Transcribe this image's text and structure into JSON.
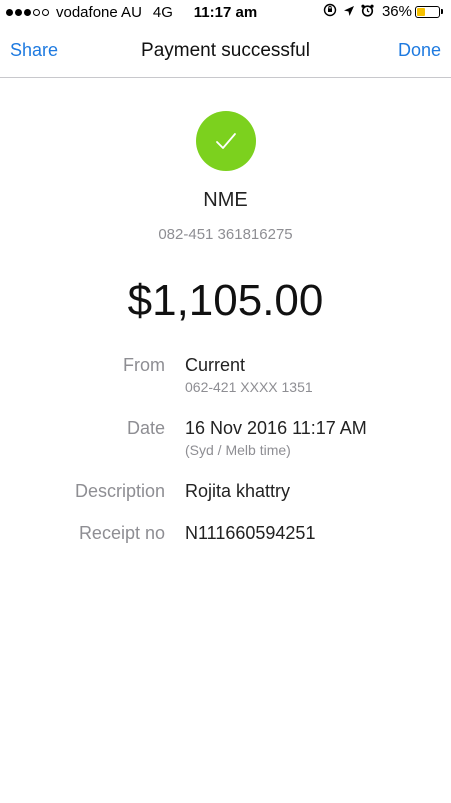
{
  "status_bar": {
    "signal_dots_full": 3,
    "signal_dots_empty": 2,
    "carrier": "vodafone AU",
    "network": "4G",
    "time": "11:17 am",
    "battery_percent": "36%",
    "battery_level": 0.36,
    "icons": [
      "rotation-lock-icon",
      "location-arrow-icon",
      "alarm-clock-icon"
    ]
  },
  "nav": {
    "share_label": "Share",
    "title": "Payment successful",
    "done_label": "Done"
  },
  "payment": {
    "status_icon": "checkmark-icon",
    "status_color": "#7cd11e",
    "payee": "NME",
    "payee_account": "082-451 361816275",
    "amount": "$1,105.00"
  },
  "details": {
    "from_label": "From",
    "from_value": "Current",
    "from_account": "062-421 XXXX 1351",
    "date_label": "Date",
    "date_value": "16 Nov 2016 11:17 AM",
    "date_note": "(Syd / Melb time)",
    "description_label": "Description",
    "description_value": "Rojita khattry",
    "receipt_label": "Receipt no",
    "receipt_value": "N111660594251"
  },
  "colors": {
    "accent": "#1e7ae0",
    "success": "#7cd11e",
    "battery": "#f5c000"
  }
}
